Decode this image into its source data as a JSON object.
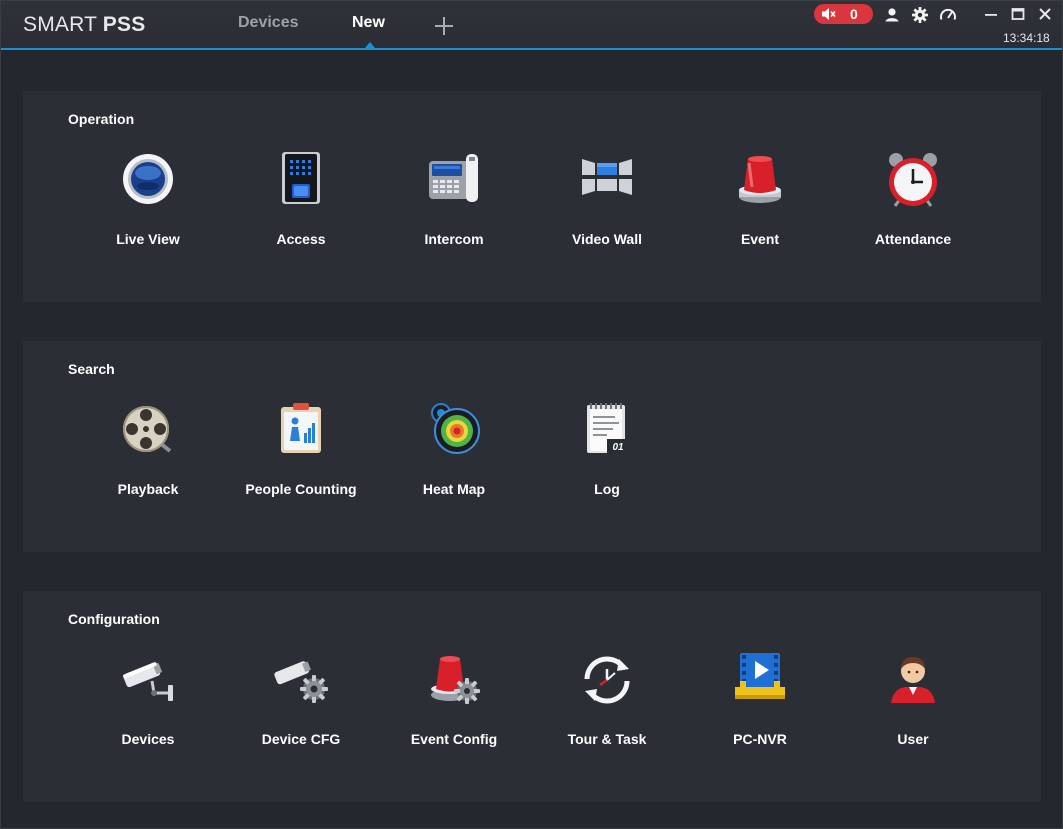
{
  "app": {
    "logo_part1": "SMART ",
    "logo_part2": "PSS"
  },
  "tabs": [
    {
      "label": "Devices",
      "active": false
    },
    {
      "label": "New",
      "active": true
    }
  ],
  "titlebar": {
    "alarm_count": "0",
    "clock": "13:34:18",
    "icons": [
      "speaker-icon",
      "user-icon",
      "gear-icon",
      "gauge-icon",
      "minimize-icon",
      "maximize-icon",
      "close-icon"
    ]
  },
  "sections": {
    "operation": {
      "title": "Operation",
      "items": [
        {
          "label": "Live View",
          "icon": "live-view-icon"
        },
        {
          "label": "Access",
          "icon": "access-icon"
        },
        {
          "label": "Intercom",
          "icon": "intercom-icon"
        },
        {
          "label": "Video Wall",
          "icon": "video-wall-icon"
        },
        {
          "label": "Event",
          "icon": "event-icon"
        },
        {
          "label": "Attendance",
          "icon": "attendance-icon"
        }
      ]
    },
    "search": {
      "title": "Search",
      "items": [
        {
          "label": "Playback",
          "icon": "playback-icon"
        },
        {
          "label": "People Counting",
          "icon": "people-counting-icon"
        },
        {
          "label": "Heat Map",
          "icon": "heat-map-icon"
        },
        {
          "label": "Log",
          "icon": "log-icon",
          "badge": "01"
        }
      ]
    },
    "configuration": {
      "title": "Configuration",
      "items": [
        {
          "label": "Devices",
          "icon": "devices-camera-icon"
        },
        {
          "label": "Device CFG",
          "icon": "device-cfg-icon"
        },
        {
          "label": "Event Config",
          "icon": "event-config-icon"
        },
        {
          "label": "Tour & Task",
          "icon": "tour-task-icon"
        },
        {
          "label": "PC-NVR",
          "icon": "pc-nvr-icon"
        },
        {
          "label": "User",
          "icon": "user-profile-icon"
        }
      ]
    }
  },
  "colors": {
    "accent": "#1a8fd6",
    "alarm": "#d9363e",
    "panel": "#2b2e35",
    "background": "#24272d"
  }
}
